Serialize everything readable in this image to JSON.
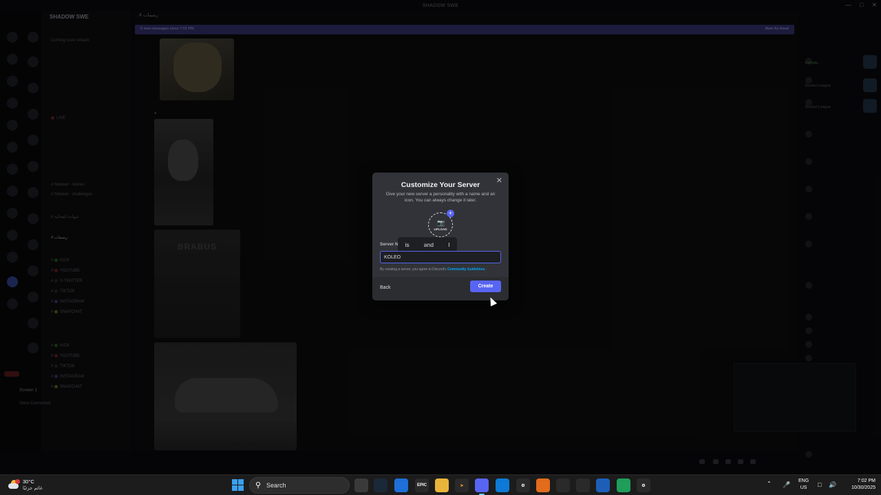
{
  "window": {
    "title": "SHADOW SWE"
  },
  "server": {
    "name": "SHADOW SWE",
    "channels": [
      "Coming soon stream",
      "LIVE",
      "follower - stories",
      "follower - challenges",
      "شهادة الفعالية",
      "رسمات",
      "KICK",
      "YOUTUBE",
      "X-TWITTER",
      "TIKTOK",
      "INSTAGRAM",
      "SNAPCHAT",
      "KICK",
      "YOUTUBE",
      "TIKTOK",
      "INSTAGRAM",
      "SNAPCHAT"
    ],
    "active_channel": "رسمات"
  },
  "user_panel": {
    "stream": "Screen 1",
    "voice_status": "Voice Connected"
  },
  "chat": {
    "header": "رسمات",
    "new_messages": "6 new messages since 7:01 PM",
    "mark_as_read": "Mark As Read",
    "brabus_text": "BRABUS"
  },
  "members": {
    "activities": [
      "Fortnite",
      "Rocket League",
      "Rocket League"
    ]
  },
  "modal": {
    "title": "Customize Your Server",
    "description": "Give your new server a personality with a name and an icon. You can always change it later.",
    "upload_label": "UPLOAD",
    "server_name_label": "Server Na",
    "server_name_value": "KOLEO",
    "suggestions": [
      "is",
      "and",
      "I"
    ],
    "terms_prefix": "By creating a server, you agree to Discord's ",
    "terms_link": "Community Guidelines",
    "terms_suffix": ".",
    "back_label": "Back",
    "create_label": "Create",
    "close_icon": "close-icon",
    "accent_color": "#5865f2"
  },
  "taskbar": {
    "weather_temp": "30°C",
    "weather_condition": "غائم جزئيًا",
    "search_label": "Search",
    "lang_line1": "ENG",
    "lang_line2": "US",
    "time": "7:02 PM",
    "date": "10/30/2025"
  }
}
